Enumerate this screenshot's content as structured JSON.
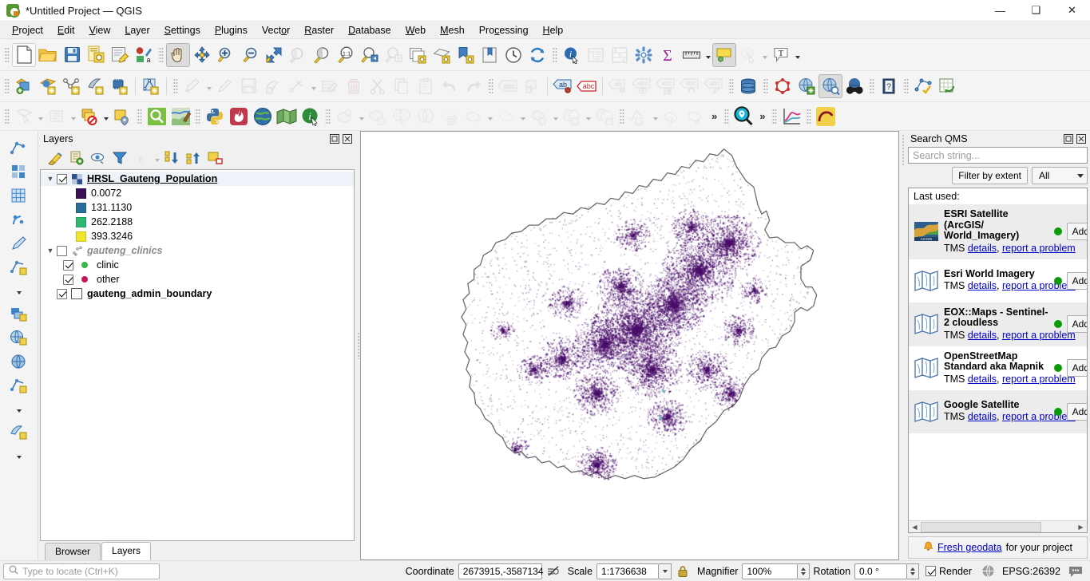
{
  "window": {
    "title": "*Untitled Project — QGIS",
    "app_icon": "qgis-logo-icon",
    "minimize": "—",
    "maximize": "❑",
    "close": "✕"
  },
  "menu": [
    {
      "label": "Project"
    },
    {
      "label": "Edit"
    },
    {
      "label": "View"
    },
    {
      "label": "Layer"
    },
    {
      "label": "Settings"
    },
    {
      "label": "Plugins"
    },
    {
      "label": "Vector"
    },
    {
      "label": "Raster"
    },
    {
      "label": "Database"
    },
    {
      "label": "Web"
    },
    {
      "label": "Mesh"
    },
    {
      "label": "Processing"
    },
    {
      "label": "Help"
    }
  ],
  "layers_panel": {
    "title": "Layers",
    "dock_icon": "undock-icon",
    "close_icon": "close-icon",
    "toolbar": [
      {
        "name": "open-layer-styling-panel",
        "icon": "paintbrush-icon"
      },
      {
        "name": "add-group",
        "icon": "add-group-icon"
      },
      {
        "name": "manage-map-themes",
        "icon": "eye-icon"
      },
      {
        "name": "filter-legend-by-map-content",
        "icon": "filter-icon"
      },
      {
        "name": "filter-legend-by-expression",
        "icon": "expression-filter-icon"
      },
      {
        "name": "expand-all",
        "icon": "expand-all-icon"
      },
      {
        "name": "collapse-all",
        "icon": "collapse-all-icon"
      },
      {
        "name": "remove-layer",
        "icon": "remove-layer-icon"
      }
    ],
    "tree": [
      {
        "name": "HRSL_Gauteng_Population",
        "type": "raster",
        "checked": true,
        "expanded": true,
        "selected": true,
        "children": [
          {
            "label": "0.0072",
            "color": "#3b0f55"
          },
          {
            "label": "131.1130",
            "color": "#2a6f97"
          },
          {
            "label": "262.2188",
            "color": "#2eb872"
          },
          {
            "label": "393.3246",
            "color": "#f2e42b"
          }
        ]
      },
      {
        "name": "gauteng_clinics",
        "type": "point",
        "checked": false,
        "expanded": true,
        "selected": false,
        "children": [
          {
            "label": "clinic",
            "color": "#3bb54a"
          },
          {
            "label": "other",
            "color": "#c2185b"
          }
        ]
      },
      {
        "name": "gauteng_admin_boundary",
        "type": "polygon",
        "checked": true,
        "expanded": false,
        "selected": false,
        "children": []
      }
    ],
    "tabs": [
      {
        "label": "Browser",
        "active": false
      },
      {
        "label": "Layers",
        "active": true
      }
    ]
  },
  "qms_panel": {
    "title": "Search QMS",
    "dock_icon": "undock-icon",
    "close_icon": "close-icon",
    "search_placeholder": "Search string...",
    "search_value": "",
    "filter_button": "Filter by extent",
    "filter_select": "All",
    "last_used_label": "Last used:",
    "add_label": "Add",
    "service_type": "TMS",
    "details_link": "details",
    "report_link": "report a problem",
    "services": [
      {
        "name": "ESRI Satellite (ArcGIS/ World_Imagery)",
        "thumb": "esri-arcgis-thumb-icon",
        "status": "online"
      },
      {
        "name": "Esri World Imagery",
        "thumb": "map-thumb-icon",
        "status": "online"
      },
      {
        "name": "EOX::Maps - Sentinel-2 cloudless",
        "thumb": "map-thumb-icon",
        "status": "online"
      },
      {
        "name": "OpenStreetMap Standard aka Mapnik",
        "thumb": "map-thumb-icon",
        "status": "online"
      },
      {
        "name": "Google Satellite",
        "thumb": "map-thumb-icon",
        "status": "online"
      }
    ],
    "footer": {
      "icon": "bell-icon",
      "link": "Fresh geodata",
      "text": "for your project"
    }
  },
  "statusbar": {
    "locate_placeholder": "Type to locate (Ctrl+K)",
    "coordinate_label": "Coordinate",
    "coordinate_value": "2673915,-3587134",
    "toggle_extents_icon": "toggle-extents-icon",
    "scale_label": "Scale",
    "scale_value": "1:1736638",
    "lock_icon": "lock-icon",
    "magnifier_label": "Magnifier",
    "magnifier_value": "100%",
    "rotation_label": "Rotation",
    "rotation_value": "0.0 °",
    "render_label": "Render",
    "render_checked": true,
    "crs_icon": "globe-icon",
    "crs_value": "EPSG:26392",
    "messages_icon": "messages-icon"
  },
  "map": {
    "layer_name": "HRSL_Gauteng_Population",
    "boundary_color": "#6b6b6b",
    "point_color": "#4b0f6b",
    "background": "#ffffff",
    "clinic_color": "#4fc3c3"
  },
  "toolbar_rows": {
    "row1": [
      {
        "name": "new-project-button",
        "icon": "new-file-icon"
      },
      {
        "name": "open-project-button",
        "icon": "open-folder-icon"
      },
      {
        "name": "save-project-button",
        "icon": "save-icon"
      },
      {
        "name": "save-project-as-button",
        "icon": "save-as-icon"
      },
      {
        "name": "new-print-layout-button",
        "icon": "layout-icon"
      },
      {
        "name": "style-manager-button",
        "icon": "style-manager-icon"
      },
      {
        "name": "pan-map-button",
        "icon": "pan-hand-icon",
        "active": true
      },
      {
        "name": "pan-to-selection-button",
        "icon": "pan-selection-icon"
      },
      {
        "name": "zoom-in-button",
        "icon": "zoom-in-icon"
      },
      {
        "name": "zoom-out-button",
        "icon": "zoom-out-icon"
      },
      {
        "name": "zoom-full-button",
        "icon": "zoom-full-icon"
      },
      {
        "name": "zoom-to-selection-button",
        "icon": "zoom-selection-icon",
        "disabled": true
      },
      {
        "name": "zoom-to-layer-button",
        "icon": "zoom-layer-icon"
      },
      {
        "name": "zoom-native-button",
        "icon": "zoom-native-icon"
      },
      {
        "name": "zoom-last-button",
        "icon": "zoom-last-icon"
      },
      {
        "name": "zoom-next-button",
        "icon": "zoom-next-icon",
        "disabled": true
      },
      {
        "name": "new-map-view-button",
        "icon": "new-map-view-icon"
      },
      {
        "name": "new-3d-map-view-button",
        "icon": "new-3d-view-icon"
      },
      {
        "name": "new-print-layout2-button",
        "icon": "new-layout-icon"
      },
      {
        "name": "show-bookmarks-button",
        "icon": "bookmark-icon"
      },
      {
        "name": "temporal-controller-button",
        "icon": "clock-icon"
      },
      {
        "name": "refresh-button",
        "icon": "refresh-icon"
      },
      {
        "name": "identify-features-button",
        "icon": "identify-icon"
      },
      {
        "name": "open-attribute-table-button",
        "icon": "attribute-table-icon",
        "disabled": true
      },
      {
        "name": "statistical-summary-button",
        "icon": "abacus-icon",
        "disabled": true
      },
      {
        "name": "processing-toolbox-button",
        "icon": "gear-icon"
      },
      {
        "name": "sum-button",
        "icon": "sigma-icon"
      },
      {
        "name": "measure-button",
        "icon": "ruler-icon"
      },
      {
        "name": "map-tips-button",
        "icon": "map-tips-icon",
        "active": true
      },
      {
        "name": "annotations-button",
        "icon": "annotation-icon",
        "disabled": true
      },
      {
        "name": "text-annotation-button",
        "icon": "text-annotation-icon"
      }
    ],
    "row2": [
      {
        "name": "open-data-source-manager-button",
        "icon": "data-source-icon"
      },
      {
        "name": "add-vector-layer-button",
        "icon": "add-vector-icon"
      },
      {
        "name": "add-delimited-text-button",
        "icon": "add-delimited-icon"
      },
      {
        "name": "add-mesh-layer-button",
        "icon": "add-mesh-icon"
      },
      {
        "name": "add-postgis-button",
        "icon": "add-postgis-icon"
      },
      {
        "name": "new-shapefile-button",
        "icon": "new-shapefile-icon"
      },
      {
        "name": "current-edits-button",
        "icon": "current-edits-icon",
        "disabled": true
      },
      {
        "name": "toggle-editing-button",
        "icon": "pencil-icon",
        "disabled": true
      },
      {
        "name": "save-layer-edits-button",
        "icon": "save-edits-icon",
        "disabled": true
      },
      {
        "name": "add-feature-button",
        "icon": "add-feature-icon",
        "disabled": true
      },
      {
        "name": "vertex-tool-button",
        "icon": "vertex-tool-icon",
        "disabled": true
      },
      {
        "name": "modify-attributes-button",
        "icon": "modify-attributes-icon",
        "disabled": true
      },
      {
        "name": "delete-selected-button",
        "icon": "trash-icon",
        "disabled": true
      },
      {
        "name": "cut-features-button",
        "icon": "scissors-icon",
        "disabled": true
      },
      {
        "name": "copy-features-button",
        "icon": "copy-icon",
        "disabled": true
      },
      {
        "name": "paste-features-button",
        "icon": "paste-icon",
        "disabled": true
      },
      {
        "name": "undo-button",
        "icon": "undo-icon",
        "disabled": true
      },
      {
        "name": "redo-button",
        "icon": "redo-icon",
        "disabled": true
      },
      {
        "name": "label-toolbar-button",
        "icon": "abc-label-icon",
        "disabled": true
      },
      {
        "name": "pin-labels-button",
        "icon": "pin-labels-icon",
        "disabled": true
      },
      {
        "name": "show-hide-labels-button",
        "icon": "show-labels-icon",
        "disabled": true
      },
      {
        "name": "highlight-pinned-button",
        "icon": "highlight-pinned-icon"
      },
      {
        "name": "move-label-button",
        "icon": "move-label-icon"
      },
      {
        "name": "rotate-label-button",
        "icon": "rotate-label-icon"
      },
      {
        "name": "change-label-button",
        "icon": "change-label-icon"
      },
      {
        "name": "database-manager-button",
        "icon": "database-icon"
      },
      {
        "name": "topology-checker-button",
        "icon": "topology-icon"
      },
      {
        "name": "metasearch-button",
        "icon": "metasearch-icon"
      },
      {
        "name": "qms-search-button",
        "icon": "qms-globe-icon",
        "active": true
      },
      {
        "name": "binoculars-button",
        "icon": "binoculars-icon"
      },
      {
        "name": "help-button",
        "icon": "help-book-icon"
      },
      {
        "name": "check-geometry-button",
        "icon": "check-geometry-icon"
      },
      {
        "name": "refresh-table-button",
        "icon": "refresh-table-icon"
      }
    ],
    "row3": [
      {
        "name": "select-features-button",
        "icon": "select-features-icon",
        "disabled": true
      },
      {
        "name": "deselect-features-button",
        "icon": "deselect-icon",
        "disabled": true
      },
      {
        "name": "select-by-value-button",
        "icon": "select-value-icon"
      },
      {
        "name": "select-by-location-button",
        "icon": "select-location-icon"
      },
      {
        "name": "find-button",
        "icon": "magnifier-green-icon"
      },
      {
        "name": "georeferencer-button",
        "icon": "georeferencer-icon"
      },
      {
        "name": "python-console-button",
        "icon": "python-icon"
      },
      {
        "name": "plugin-manager-button",
        "icon": "plugin-icon"
      },
      {
        "name": "globe-plugin-button",
        "icon": "earth-icon"
      },
      {
        "name": "green-map-button",
        "icon": "green-map-icon"
      },
      {
        "name": "info-button",
        "icon": "info-cursor-icon"
      },
      {
        "name": "buffer-button",
        "icon": "buffer-icon",
        "disabled": true
      },
      {
        "name": "clip-button",
        "icon": "clip-icon",
        "disabled": true
      },
      {
        "name": "dissolve-button",
        "icon": "dissolve-icon",
        "disabled": true
      },
      {
        "name": "intersect-button",
        "icon": "intersect-icon",
        "disabled": true
      },
      {
        "name": "union-button",
        "icon": "union-icon",
        "disabled": true
      },
      {
        "name": "symmetric-difference-button",
        "icon": "symdiff-icon",
        "disabled": true
      },
      {
        "name": "difference-button",
        "icon": "difference-icon",
        "disabled": true
      },
      {
        "name": "merge-button",
        "icon": "merge-icon",
        "disabled": true
      },
      {
        "name": "split-button",
        "icon": "split-icon",
        "disabled": true
      },
      {
        "name": "multipart-button",
        "icon": "multipart-icon",
        "disabled": true
      },
      {
        "name": "offset-curve-button",
        "icon": "offset-curve-icon",
        "disabled": true
      },
      {
        "name": "integrate-button",
        "icon": "integrate-icon",
        "disabled": true
      },
      {
        "name": "derivative-button",
        "icon": "derivative-icon",
        "disabled": true
      },
      {
        "name": "qms-locator-button",
        "icon": "qms-locator-icon"
      },
      {
        "name": "plot-button",
        "icon": "plot-icon"
      },
      {
        "name": "profile-button",
        "icon": "profile-yellow-icon"
      }
    ]
  },
  "rail": [
    {
      "name": "digitize-tool",
      "icon": "vertex-blue-icon"
    },
    {
      "name": "raster-calc-tool",
      "icon": "raster-blue-icon"
    },
    {
      "name": "grid-tool",
      "icon": "grid-blue-icon"
    },
    {
      "name": "sample-tool",
      "icon": "sample-blue-icon"
    },
    {
      "name": "edit-tool",
      "icon": "pen-blue-icon"
    },
    {
      "name": "vector-tool",
      "icon": "vector-blue-icon"
    },
    {
      "name": "layer-stack-tool",
      "icon": "stack-blue-icon"
    },
    {
      "name": "earth-tool",
      "icon": "earth-blue-icon"
    },
    {
      "name": "web-tool",
      "icon": "web-blue-icon"
    },
    {
      "name": "export-tool",
      "icon": "export-blue-icon"
    },
    {
      "name": "mesh-tool",
      "icon": "mesh-blue-icon"
    }
  ]
}
